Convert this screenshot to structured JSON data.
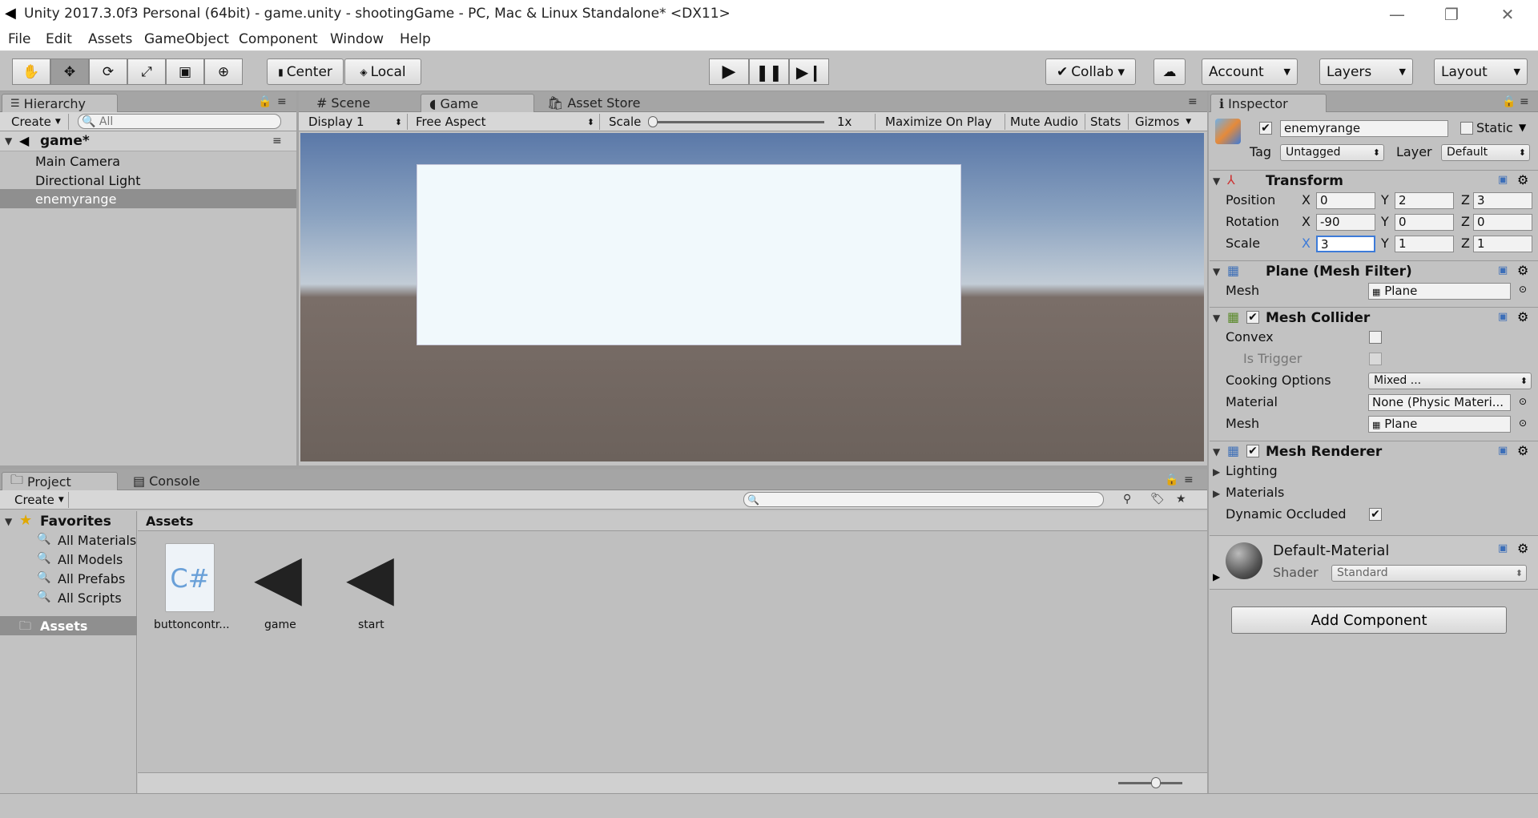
{
  "window": {
    "title": "Unity 2017.3.0f3 Personal (64bit) - game.unity - shootingGame - PC, Mac & Linux Standalone* <DX11>"
  },
  "menu": [
    "File",
    "Edit",
    "Assets",
    "GameObject",
    "Component",
    "Window",
    "Help"
  ],
  "toolbar": {
    "pivot": "Center",
    "space": "Local",
    "collab": "Collab ▾",
    "account": "Account",
    "layers": "Layers",
    "layout": "Layout"
  },
  "hierarchy": {
    "tab": "Hierarchy",
    "create": "Create",
    "search_placeholder": "All",
    "scene": "game*",
    "items": [
      "Main Camera",
      "Directional Light",
      "enemyrange"
    ]
  },
  "center_tabs": [
    "Scene",
    "Game",
    "Asset Store"
  ],
  "game_bar": {
    "display": "Display 1",
    "aspect": "Free Aspect",
    "scale_label": "Scale",
    "scale_value": "1x",
    "maximize": "Maximize On Play",
    "mute": "Mute Audio",
    "stats": "Stats",
    "gizmos": "Gizmos"
  },
  "inspector": {
    "tab": "Inspector",
    "object_name": "enemyrange",
    "static_label": "Static",
    "tag_label": "Tag",
    "tag_value": "Untagged",
    "layer_label": "Layer",
    "layer_value": "Default",
    "transform": {
      "title": "Transform",
      "position_label": "Position",
      "rotation_label": "Rotation",
      "scale_label": "Scale",
      "position": [
        "0",
        "2",
        "3"
      ],
      "rotation": [
        "-90",
        "0",
        "0"
      ],
      "scale": [
        "3",
        "1",
        "1"
      ],
      "axis": [
        "X",
        "Y",
        "Z"
      ]
    },
    "mesh_filter": {
      "title": "Plane (Mesh Filter)",
      "mesh_label": "Mesh",
      "mesh_value": "Plane"
    },
    "mesh_collider": {
      "title": "Mesh Collider",
      "convex_label": "Convex",
      "trigger_label": "Is Trigger",
      "cooking_label": "Cooking Options",
      "cooking_value": "Mixed ...",
      "material_label": "Material",
      "material_value": "None (Physic Materi...",
      "mesh_label": "Mesh",
      "mesh_value": "Plane"
    },
    "mesh_renderer": {
      "title": "Mesh Renderer",
      "lighting": "Lighting",
      "materials": "Materials",
      "dynamic_occluded": "Dynamic Occluded"
    },
    "material": {
      "name": "Default-Material",
      "shader_label": "Shader",
      "shader_value": "Standard"
    },
    "add_component": "Add Component"
  },
  "bottom_tabs": [
    "Project",
    "Console"
  ],
  "project": {
    "create": "Create",
    "favorites_label": "Favorites",
    "favorites": [
      "All Materials",
      "All Models",
      "All Prefabs",
      "All Scripts"
    ],
    "assets_root": "Assets",
    "breadcrumb": "Assets",
    "assets": [
      {
        "name": "buttoncontr...",
        "type": "C#"
      },
      {
        "name": "game",
        "type": "unity"
      },
      {
        "name": "start",
        "type": "unity"
      }
    ]
  },
  "colors": {
    "panel_bg": "#c2c2c2",
    "selection": "#8f8f8f",
    "blue_select": "#3d7bd8"
  }
}
